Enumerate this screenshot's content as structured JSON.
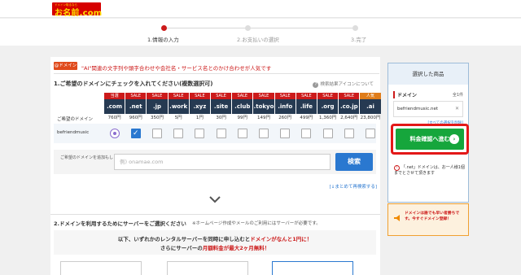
{
  "header": {
    "logo_tag": "ドメイン取るなら",
    "logo_text": "お名前.com",
    "logo_sub": "by GMO"
  },
  "steps": [
    {
      "label": "1.情報の入力",
      "active": true
    },
    {
      "label": "2.お支払いの選択",
      "active": false
    },
    {
      "label": "3.完了",
      "active": false
    }
  ],
  "ad": {
    "tag": "@ドメイン",
    "text": "\"AI\"関連の文字列や頭字合わせや会社名・サービス名とのかけ合わせが人気です"
  },
  "domain_section": {
    "title": "1.ご希望のドメインにチェックを入れてください(複数選択可)",
    "hint": "検索結果アイコンについて",
    "row_label_name": "ご希望のドメイン",
    "query": "befriendmusic",
    "tlds": [
      {
        "sale": "当選",
        "name": ".com",
        "price": "760円",
        "state": "unavailable",
        "badge": "red"
      },
      {
        "sale": "SALE",
        "name": ".net",
        "price": "960円",
        "state": "checked",
        "badge": "red"
      },
      {
        "sale": "SALE",
        "name": ".jp",
        "price": "350円",
        "state": "unchecked",
        "badge": "red"
      },
      {
        "sale": "SALE",
        "name": ".work",
        "price": "5円",
        "state": "unchecked",
        "badge": "red"
      },
      {
        "sale": "SALE",
        "name": ".xyz",
        "price": "1円",
        "state": "unchecked",
        "badge": "red"
      },
      {
        "sale": "SALE",
        "name": ".site",
        "price": "30円",
        "state": "unchecked",
        "badge": "red"
      },
      {
        "sale": "SALE",
        "name": ".club",
        "price": "99円",
        "state": "unchecked",
        "badge": "red"
      },
      {
        "sale": "SALE",
        "name": ".tokyo",
        "price": "149円",
        "state": "unchecked",
        "badge": "red"
      },
      {
        "sale": "SALE",
        "name": ".info",
        "price": "260円",
        "state": "unchecked",
        "badge": "red"
      },
      {
        "sale": "SALE",
        "name": ".life",
        "price": "499円",
        "state": "unchecked",
        "badge": "red"
      },
      {
        "sale": "SALE",
        "name": ".org",
        "price": "1,360円",
        "state": "unchecked",
        "badge": "red"
      },
      {
        "sale": "SALE",
        "name": ".co.jp",
        "price": "2,640円",
        "state": "unchecked",
        "badge": "red"
      },
      {
        "sale": "人気",
        "name": ".ai",
        "price": "23,800円",
        "state": "unchecked",
        "badge": "orange"
      }
    ],
    "search_label": "ご希望のドメインを追加もしくは再検索する",
    "search_placeholder": "例) onamae.com",
    "search_button": "検索",
    "bulk_link": "[↓まとめて再検索する]"
  },
  "server_section": {
    "title": "2.ドメインを利用するためにサーバーをご選択ください",
    "note": "※ホームページ作成やメールのご利用にはサーバーが必要です。",
    "promo_line1_a": "以下、いずれかのレンタルサーバーを同時に申し込むと",
    "promo_line1_b": "ドメインがなんと1円に！",
    "promo_line2_a": "さらにサーバーの",
    "promo_line2_b": "月額料金が最大2ヶ月無料！"
  },
  "cart": {
    "title": "選択した商品",
    "domain_label": "ドメイン",
    "count": "全1件",
    "item": "befriendmusic.net",
    "clear_link": "[すべての選択を削除]",
    "cta": "料金確認へ進む",
    "note": "「.net」ドメインは、お一人様1個までとさせて頂きます"
  },
  "side_banner": {
    "text": "ドメインは誰でも早い者勝ちです。今すぐドメイン登録！"
  },
  "colors": {
    "brand_red": "#cc1a1a",
    "tld_header": "#263a52",
    "cta_green": "#16a63c",
    "search_blue": "#2a78d0"
  }
}
